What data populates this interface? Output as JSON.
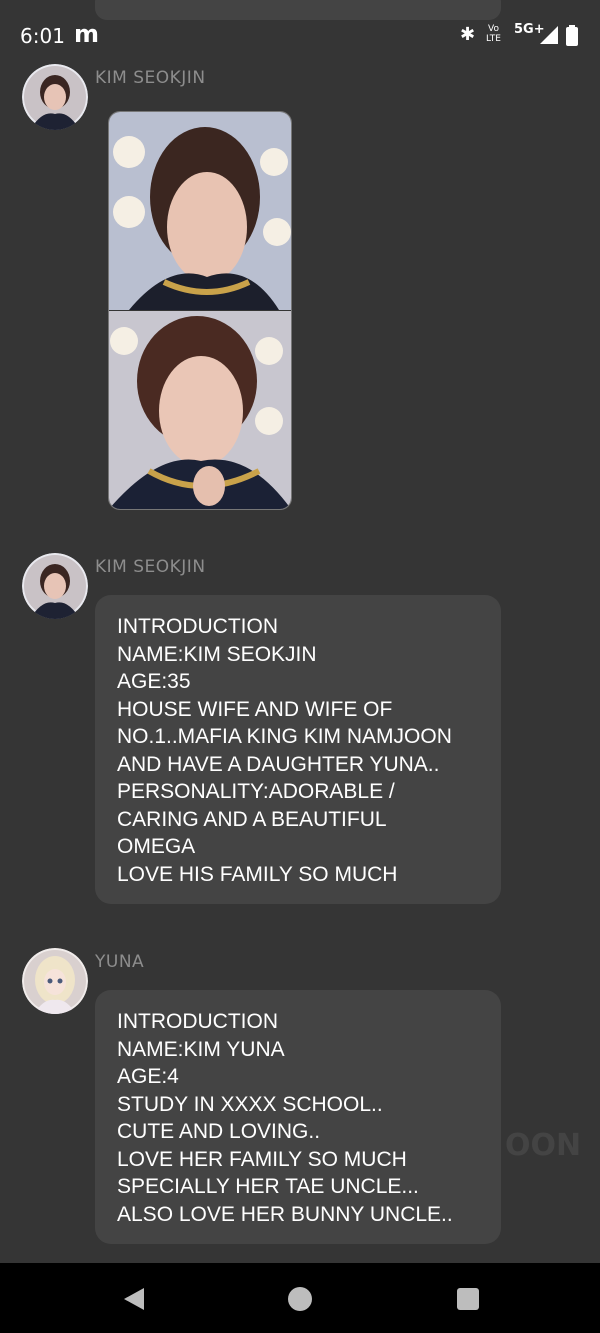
{
  "status": {
    "time": "6:01",
    "app_badge": "m",
    "bluetooth_icon": "bluetooth-icon",
    "volte_top": "Vo",
    "volte_bottom": "LTE",
    "network": "5G+"
  },
  "messages": [
    {
      "sender": "KIM SEOKJIN",
      "type": "image"
    },
    {
      "sender": "KIM SEOKJIN",
      "type": "text",
      "lines": [
        "INTRODUCTION",
        "NAME:KIM SEOKJIN",
        "AGE:35",
        "HOUSE WIFE AND WIFE OF",
        "NO.1..MAFIA KING KIM NAMJOON",
        "AND HAVE A DAUGHTER YUNA..",
        "PERSONALITY:ADORABLE /",
        "CARING AND A BEAUTIFUL",
        "OMEGA",
        "LOVE HIS FAMILY SO MUCH"
      ]
    },
    {
      "sender": "YUNA",
      "type": "text",
      "lines": [
        "INTRODUCTION",
        "NAME:KIM YUNA",
        "AGE:4",
        "STUDY IN XXXX SCHOOL..",
        "CUTE AND LOVING..",
        "LOVE HER FAMILY SO MUCH",
        "SPECIALLY HER TAE UNCLE...",
        "ALSO LOVE HER BUNNY UNCLE.."
      ]
    }
  ],
  "watermark": "OON",
  "colors": {
    "background": "#353535",
    "bubble": "#444444",
    "sender": "#8d8d8d"
  }
}
